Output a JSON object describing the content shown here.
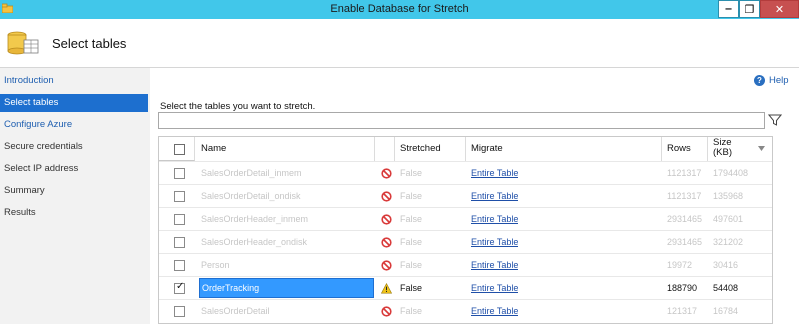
{
  "window": {
    "title": "Enable Database for Stretch",
    "min_label": "‒",
    "max_label": "❐",
    "close_label": "✕"
  },
  "header": {
    "title": "Select tables"
  },
  "sidebar": {
    "items": [
      {
        "label": "Introduction"
      },
      {
        "label": "Select tables"
      },
      {
        "label": "Configure Azure"
      },
      {
        "label": "Secure credentials"
      },
      {
        "label": "Select IP address"
      },
      {
        "label": "Summary"
      },
      {
        "label": "Results"
      }
    ]
  },
  "help": {
    "label": "Help"
  },
  "main": {
    "instruction": "Select the tables you want to stretch.",
    "search": {
      "value": "",
      "placeholder": ""
    }
  },
  "grid": {
    "columns": {
      "name": "Name",
      "stretched": "Stretched",
      "migrate": "Migrate",
      "rows": "Rows",
      "size": "Size (KB)"
    },
    "rows": [
      {
        "name": "SalesOrderDetail_inmem",
        "stretched": "False",
        "migrate": "Entire Table",
        "rows": "1121317",
        "size": "1794408",
        "checked": false,
        "status": "blocked"
      },
      {
        "name": "SalesOrderDetail_ondisk",
        "stretched": "False",
        "migrate": "Entire Table",
        "rows": "1121317",
        "size": "135968",
        "checked": false,
        "status": "blocked"
      },
      {
        "name": "SalesOrderHeader_inmem",
        "stretched": "False",
        "migrate": "Entire Table",
        "rows": "2931465",
        "size": "497601",
        "checked": false,
        "status": "blocked"
      },
      {
        "name": "SalesOrderHeader_ondisk",
        "stretched": "False",
        "migrate": "Entire Table",
        "rows": "2931465",
        "size": "321202",
        "checked": false,
        "status": "blocked"
      },
      {
        "name": "Person",
        "stretched": "False",
        "migrate": "Entire Table",
        "rows": "19972",
        "size": "30416",
        "checked": false,
        "status": "blocked"
      },
      {
        "name": "OrderTracking",
        "stretched": "False",
        "migrate": "Entire Table",
        "rows": "188790",
        "size": "54408",
        "checked": true,
        "status": "warning"
      },
      {
        "name": "SalesOrderDetail",
        "stretched": "False",
        "migrate": "Entire Table",
        "rows": "121317",
        "size": "16784",
        "checked": false,
        "status": "blocked"
      }
    ]
  },
  "colors": {
    "titlebar": "#41c7ea",
    "selection": "#1d6fcf",
    "link": "#1f5fb0",
    "blocked": "#d93a3a",
    "warning": "#f0c419"
  }
}
